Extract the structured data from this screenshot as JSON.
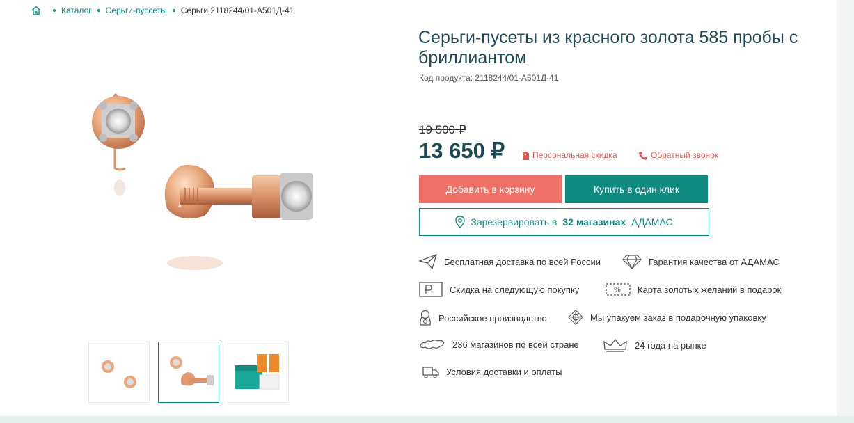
{
  "breadcrumb": {
    "items": [
      "Каталог",
      "Серьги-пуссеты"
    ],
    "current": "Серьги 2118244/01-А501Д-41"
  },
  "product": {
    "title": "Серьги-пусеты из красного золота 585 пробы с бриллиантом",
    "code": "Код продукта: 2118244/01-А501Д-41",
    "old_price": "19 500 ₽",
    "price": "13 650 ₽",
    "personal_discount": "Персональная скидка",
    "callback": "Обратный звонок"
  },
  "actions": {
    "add_to_cart": "Добавить в корзину",
    "buy_one_click": "Купить в один клик",
    "reserve_prefix": "Зарезервировать в",
    "reserve_count": "32 магазинах",
    "reserve_brand": "АДАМАС"
  },
  "features": {
    "delivery": "Бесплатная доставка по всей России",
    "warranty": "Гарантия качества от АДАМАС",
    "discount": "Скидка на следующую покупку",
    "gold_card": "Карта золотых желаний в подарок",
    "russian": "Российское производство",
    "gift_pack": "Мы упакуем заказ в подарочную упаковку",
    "stores": "236 магазинов по всей стране",
    "years": "24 года на рынке",
    "conditions": "Условия доставки и оплаты"
  },
  "colors": {
    "accent": "#0f8a7e",
    "cart": "#ef7067",
    "title": "#1d4a54",
    "promo": "#e05a52"
  }
}
